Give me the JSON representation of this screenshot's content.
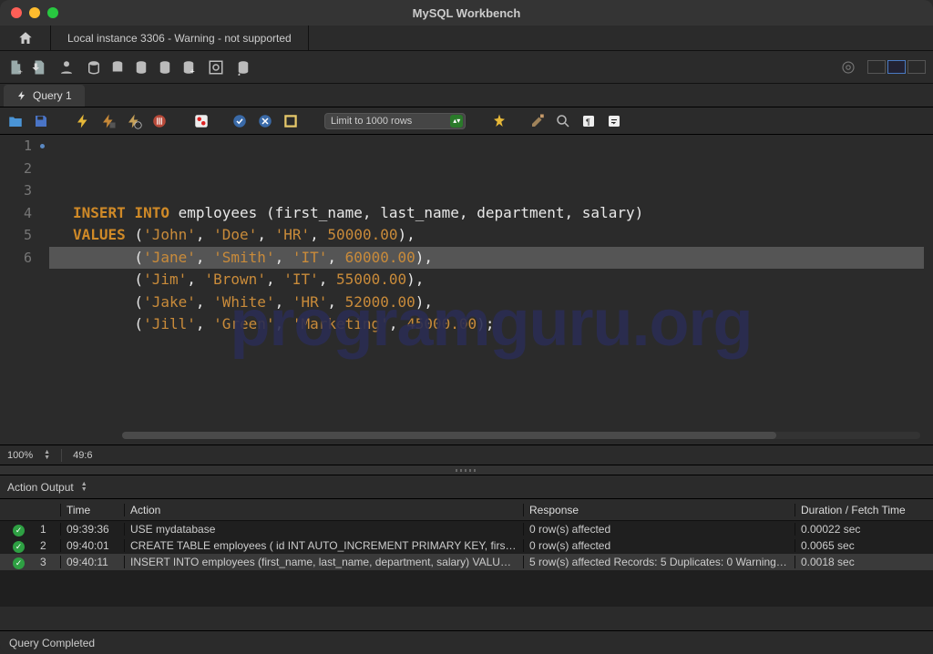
{
  "window": {
    "title": "MySQL Workbench"
  },
  "connection_tab": "Local instance 3306 - Warning - not supported",
  "query_tab": "Query 1",
  "limit_select": "Limit to 1000 rows",
  "editor_footer": {
    "zoom": "100%",
    "cursor": "49:6"
  },
  "code_tokens": [
    [
      {
        "t": "INSERT",
        "c": "kw"
      },
      {
        "t": " ",
        "c": "ident"
      },
      {
        "t": "INTO",
        "c": "kw"
      },
      {
        "t": " ",
        "c": "ident"
      },
      {
        "t": "employees",
        "c": "ident"
      },
      {
        "t": " ",
        "c": "ident"
      },
      {
        "t": "(",
        "c": "paren"
      },
      {
        "t": "first_name",
        "c": "ident"
      },
      {
        "t": ",",
        "c": "punct"
      },
      {
        "t": " ",
        "c": "ident"
      },
      {
        "t": "last_name",
        "c": "ident"
      },
      {
        "t": ",",
        "c": "punct"
      },
      {
        "t": " ",
        "c": "ident"
      },
      {
        "t": "department",
        "c": "ident"
      },
      {
        "t": ",",
        "c": "punct"
      },
      {
        "t": " ",
        "c": "ident"
      },
      {
        "t": "salary",
        "c": "ident"
      },
      {
        "t": ")",
        "c": "paren"
      }
    ],
    [
      {
        "t": "VALUES",
        "c": "kw"
      },
      {
        "t": " ",
        "c": "ident"
      },
      {
        "t": "(",
        "c": "paren"
      },
      {
        "t": "'John'",
        "c": "str"
      },
      {
        "t": ",",
        "c": "punct"
      },
      {
        "t": " ",
        "c": "ident"
      },
      {
        "t": "'Doe'",
        "c": "str"
      },
      {
        "t": ",",
        "c": "punct"
      },
      {
        "t": " ",
        "c": "ident"
      },
      {
        "t": "'HR'",
        "c": "str"
      },
      {
        "t": ",",
        "c": "punct"
      },
      {
        "t": " ",
        "c": "ident"
      },
      {
        "t": "50000.00",
        "c": "num"
      },
      {
        "t": ")",
        "c": "paren"
      },
      {
        "t": ",",
        "c": "punct"
      }
    ],
    [
      {
        "t": "       (",
        "c": "paren"
      },
      {
        "t": "'Jane'",
        "c": "str"
      },
      {
        "t": ",",
        "c": "punct"
      },
      {
        "t": " ",
        "c": "ident"
      },
      {
        "t": "'Smith'",
        "c": "str"
      },
      {
        "t": ",",
        "c": "punct"
      },
      {
        "t": " ",
        "c": "ident"
      },
      {
        "t": "'IT'",
        "c": "str"
      },
      {
        "t": ",",
        "c": "punct"
      },
      {
        "t": " ",
        "c": "ident"
      },
      {
        "t": "60000.00",
        "c": "num"
      },
      {
        "t": ")",
        "c": "paren"
      },
      {
        "t": ",",
        "c": "punct"
      }
    ],
    [
      {
        "t": "       (",
        "c": "paren"
      },
      {
        "t": "'Jim'",
        "c": "str"
      },
      {
        "t": ",",
        "c": "punct"
      },
      {
        "t": " ",
        "c": "ident"
      },
      {
        "t": "'Brown'",
        "c": "str"
      },
      {
        "t": ",",
        "c": "punct"
      },
      {
        "t": " ",
        "c": "ident"
      },
      {
        "t": "'IT'",
        "c": "str"
      },
      {
        "t": ",",
        "c": "punct"
      },
      {
        "t": " ",
        "c": "ident"
      },
      {
        "t": "55000.00",
        "c": "num"
      },
      {
        "t": ")",
        "c": "paren"
      },
      {
        "t": ",",
        "c": "punct"
      }
    ],
    [
      {
        "t": "       (",
        "c": "paren"
      },
      {
        "t": "'Jake'",
        "c": "str"
      },
      {
        "t": ",",
        "c": "punct"
      },
      {
        "t": " ",
        "c": "ident"
      },
      {
        "t": "'White'",
        "c": "str"
      },
      {
        "t": ",",
        "c": "punct"
      },
      {
        "t": " ",
        "c": "ident"
      },
      {
        "t": "'HR'",
        "c": "str"
      },
      {
        "t": ",",
        "c": "punct"
      },
      {
        "t": " ",
        "c": "ident"
      },
      {
        "t": "52000.00",
        "c": "num"
      },
      {
        "t": ")",
        "c": "paren"
      },
      {
        "t": ",",
        "c": "punct"
      }
    ],
    [
      {
        "t": "       (",
        "c": "paren"
      },
      {
        "t": "'Jill'",
        "c": "str"
      },
      {
        "t": ",",
        "c": "punct"
      },
      {
        "t": " ",
        "c": "ident"
      },
      {
        "t": "'Green'",
        "c": "str"
      },
      {
        "t": ",",
        "c": "punct"
      },
      {
        "t": " ",
        "c": "ident"
      },
      {
        "t": "'Marketing'",
        "c": "str"
      },
      {
        "t": ",",
        "c": "punct"
      },
      {
        "t": " ",
        "c": "ident"
      },
      {
        "t": "45000.00",
        "c": "num"
      },
      {
        "t": ")",
        "c": "paren"
      },
      {
        "t": ";",
        "c": "punct"
      }
    ]
  ],
  "watermark": "programguru.org",
  "action_output": {
    "label": "Action Output",
    "headers": {
      "time": "Time",
      "action": "Action",
      "response": "Response",
      "duration": "Duration / Fetch Time"
    },
    "rows": [
      {
        "idx": "1",
        "time": "09:39:36",
        "action": "USE mydatabase",
        "response": "0 row(s) affected",
        "duration": "0.00022 sec"
      },
      {
        "idx": "2",
        "time": "09:40:01",
        "action": "CREATE TABLE employees (     id INT AUTO_INCREMENT PRIMARY KEY,     first_n…",
        "response": "0 row(s) affected",
        "duration": "0.0065 sec"
      },
      {
        "idx": "3",
        "time": "09:40:11",
        "action": "INSERT INTO employees (first_name, last_name, department, salary) VALUES ('J…",
        "response": "5 row(s) affected Records: 5  Duplicates: 0  Warnings…",
        "duration": "0.0018 sec",
        "sel": true
      }
    ]
  },
  "statusbar": "Query Completed"
}
